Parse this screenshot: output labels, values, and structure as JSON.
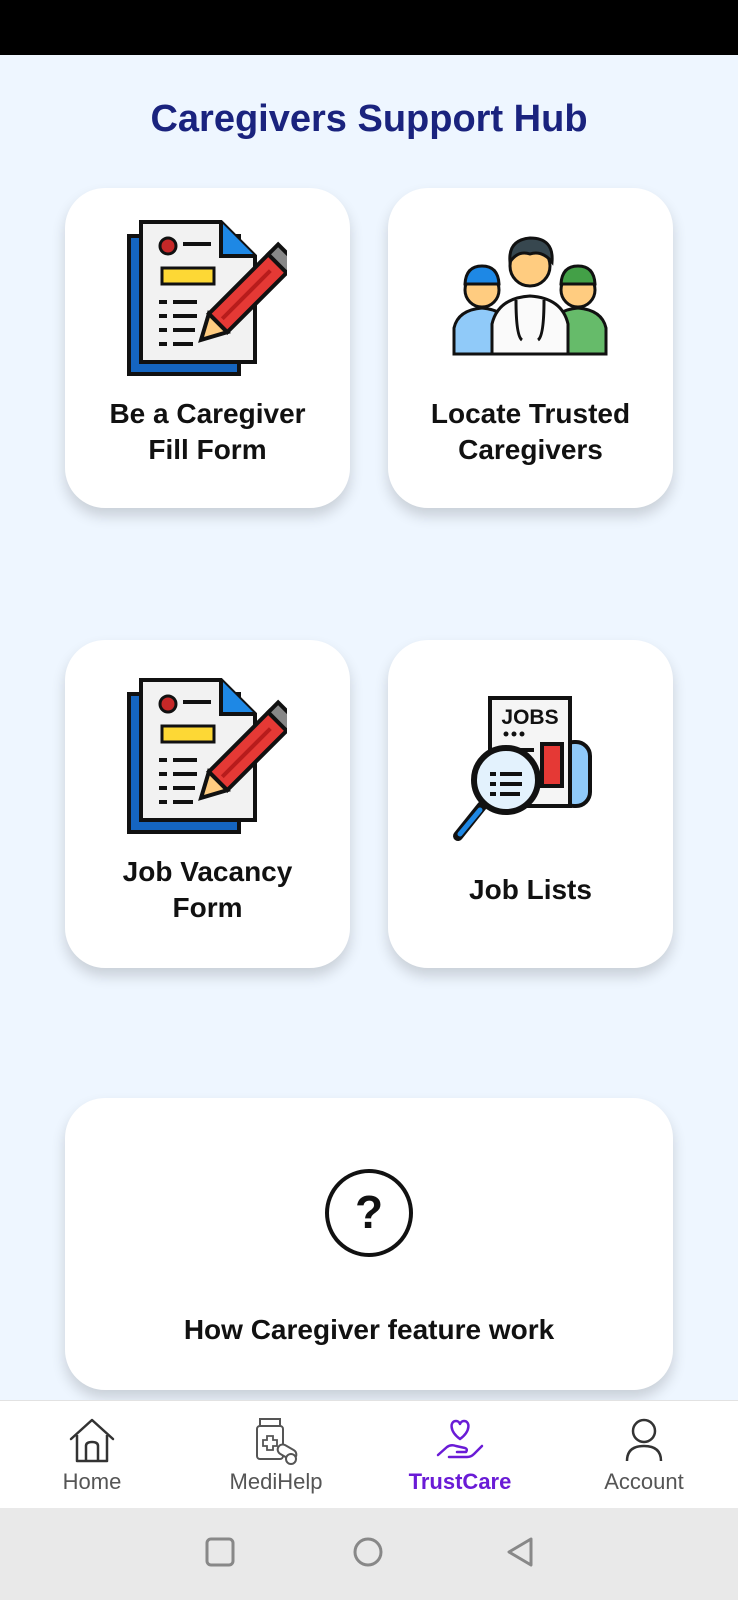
{
  "header": {
    "title": "Caregivers Support Hub"
  },
  "cards": [
    {
      "label": "Be a Caregiver\nFill  Form",
      "icon": "form-pencil-icon"
    },
    {
      "label": "Locate Trusted\nCaregivers",
      "icon": "caregivers-group-icon"
    },
    {
      "label": "Job Vacancy\nForm",
      "icon": "form-pencil-icon"
    },
    {
      "label": "Job Lists",
      "icon": "jobs-search-icon",
      "icon_text": "JOBS"
    },
    {
      "label": "How Caregiver feature work",
      "icon": "question-circle-icon",
      "icon_text": "?"
    }
  ],
  "bottom_nav": [
    {
      "label": "Home",
      "icon": "home-icon"
    },
    {
      "label": "MediHelp",
      "icon": "medicine-icon"
    },
    {
      "label": "TrustCare",
      "icon": "heart-hand-icon",
      "active": true
    },
    {
      "label": "Account",
      "icon": "person-icon"
    }
  ],
  "system_nav": [
    "square-recents-icon",
    "circle-home-icon",
    "triangle-back-icon"
  ],
  "colors": {
    "title": "#1A237E",
    "active": "#6A1BD6",
    "background": "#EEF6FF",
    "form_blue": "#1565C0",
    "pencil_red": "#E53935",
    "highlight_yellow": "#FDD835"
  }
}
